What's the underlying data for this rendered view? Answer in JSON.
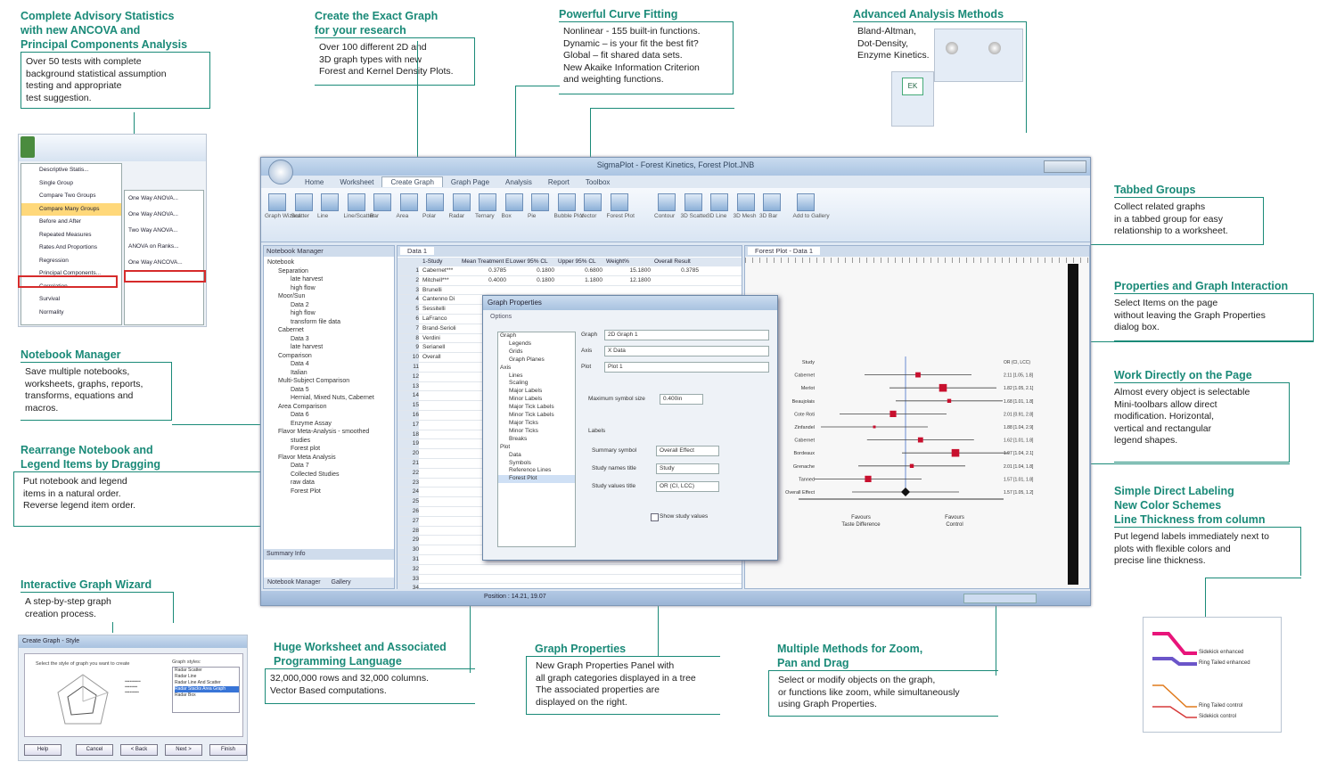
{
  "colors": {
    "accent": "#1a8a78",
    "window": "#dfe8f3",
    "forest_marker": "#c8102e"
  },
  "callouts": {
    "advisory": {
      "title": [
        "Complete Advisory Statistics",
        "with new ANCOVA and",
        "Principal Components Analysis"
      ],
      "body": [
        "Over 50 tests with complete",
        "background statistical assumption",
        "testing and appropriate",
        "test suggestion."
      ]
    },
    "create_graph": {
      "title": [
        "Create the Exact Graph",
        "for your research"
      ],
      "body": [
        "Over 100 different 2D and",
        "3D graph types with new",
        "Forest  and Kernel Density Plots."
      ]
    },
    "curve": {
      "title": [
        "Powerful Curve Fitting"
      ],
      "body": [
        "Nonlinear - 155 built-in functions.",
        "Dynamic – is your fit the best fit?",
        "Global – fit shared data sets.",
        "New Akaike Information Criterion",
        "and weighting functions."
      ]
    },
    "advanced": {
      "title": [
        "Advanced Analysis Methods"
      ],
      "body": [
        "Bland-Altman,",
        "Dot-Density,",
        "Enzyme Kinetics."
      ]
    },
    "tabbed": {
      "title": [
        "Tabbed Groups"
      ],
      "body": [
        "Collect related graphs",
        "in a tabbed group for easy",
        "relationship to a worksheet."
      ]
    },
    "properties_interaction": {
      "title": [
        "Properties and Graph Interaction"
      ],
      "body": [
        "Select Items on the page",
        "without leaving the Graph Properties",
        "dialog box."
      ]
    },
    "work_directly": {
      "title": [
        "Work Directly on the Page"
      ],
      "body": [
        "Almost every object is selectable",
        "Mini-toolbars allow direct",
        "modification. Horizontal,",
        "vertical and rectangular",
        "legend shapes."
      ]
    },
    "labeling": {
      "title": [
        "Simple Direct Labeling",
        "New Color Schemes",
        "Line Thickness from column"
      ],
      "body": [
        "Put legend labels immediately next to",
        "plots with flexible colors and",
        "precise line thickness."
      ]
    },
    "notebook": {
      "title": [
        "Notebook Manager"
      ],
      "body": [
        "Save multiple notebooks,",
        "worksheets, graphs, reports,",
        "transforms, equations and",
        "macros."
      ]
    },
    "rearrange": {
      "title": [
        "Rearrange Notebook and",
        "Legend Items by Dragging"
      ],
      "body": [
        "Put notebook and legend",
        "items in a natural order.",
        "Reverse legend item order."
      ]
    },
    "wizard": {
      "title": [
        "Interactive Graph Wizard"
      ],
      "body": [
        "A step-by-step graph",
        "creation process."
      ]
    },
    "worksheet": {
      "title": [
        "Huge Worksheet and Associated",
        "Programming Language"
      ],
      "body": [
        "32,000,000 rows and 32,000 columns.",
        "Vector Based computations."
      ]
    },
    "graph_props": {
      "title": [
        "Graph Properties"
      ],
      "body": [
        "New Graph Properties Panel with",
        "all graph categories displayed in a tree",
        "The associated properties are",
        "displayed on the right."
      ]
    },
    "zoom": {
      "title": [
        "Multiple Methods for Zoom,",
        "Pan and Drag"
      ],
      "body": [
        "Select or modify objects on the graph,",
        "or functions like zoom, while simultaneously",
        "using Graph Properties."
      ]
    }
  },
  "app": {
    "title": "SigmaPlot - Forest Kinetics, Forest Plot.JNB",
    "tabs": [
      "Home",
      "Worksheet",
      "Create Graph",
      "Graph Page",
      "Analysis",
      "Report",
      "Toolbox"
    ],
    "active_tab": "Create Graph",
    "ribbon_labels": [
      "Graph Wizard",
      "Scatter",
      "Line",
      "Line/Scatter",
      "Bar",
      "Area",
      "Polar",
      "Radar",
      "Ternary",
      "Box",
      "Pie",
      "Bubble Plot",
      "Vector",
      "Forest Plot",
      "Contour",
      "3D Scatter",
      "3D Line",
      "3D Mesh",
      "3D Bar",
      "Add to Gallery"
    ],
    "notebook_title": "Notebook Manager",
    "notebook_items": [
      "Notebook",
      "Separation",
      "late harvest",
      "high flow",
      "Moor/Sun",
      "Data 2",
      "high flow",
      "transform file data",
      "Cabernet",
      "Data 3",
      "late harvest",
      "Comparison",
      "Data 4",
      "Italian",
      "Multi-Subject Comparison",
      "Data 5",
      "Hernial, Mixed Nuts, Cabernet",
      "Area Comparison",
      "Data 6",
      "Enzyme Assay",
      "Flavor Meta-Analysis - smoothed",
      "studies",
      "Forest plot",
      "Flavor Meta Analysis",
      "Data 7",
      "Collected Studies",
      "raw data",
      "Forest Plot"
    ],
    "worksheet_tab": "Data 1",
    "worksheet_cols": [
      "1-Study",
      "Mean Treatment E",
      "Lower 95% CL",
      "Upper 95% CL",
      "Weight%",
      "Overall Result"
    ],
    "worksheet_rows": [
      [
        "Cabernet***",
        "0.3785",
        "0.1800",
        "0.6800",
        "15.1800",
        "0.3785"
      ],
      [
        "Mitchell***",
        "0.4000",
        "0.1800",
        "1.1800",
        "12.1800",
        ""
      ],
      [
        "Brunelli",
        "",
        "",
        "",
        "",
        ""
      ],
      [
        "Cantenno Di",
        "",
        "",
        "",
        "",
        ""
      ],
      [
        "Sessitelli",
        "",
        "",
        "",
        "",
        ""
      ],
      [
        "LaFranco",
        "",
        "",
        "",
        "",
        ""
      ],
      [
        "Brand-Serioli",
        "",
        "",
        "",
        "",
        ""
      ],
      [
        "Verdini",
        "",
        "",
        "",
        "",
        ""
      ],
      [
        "Serianell",
        "",
        "",
        "",
        "",
        ""
      ],
      [
        "Overall",
        "",
        "",
        "",
        "",
        ""
      ]
    ],
    "graph_tab": "Forest Plot - Data 1",
    "summary_info": "Summary Info",
    "bottom_tabs": [
      "Notebook Manager",
      "Gallery"
    ],
    "status": "Position : 14.21, 19.07"
  },
  "dialog": {
    "title": "Graph Properties",
    "options_label": "Options",
    "tree": [
      "Graph",
      "Legends",
      "Grids",
      "Graph Planes",
      "Axis",
      "Lines",
      "Scaling",
      "Major Labels",
      "Minor Labels",
      "Major Tick Labels",
      "Minor Tick Labels",
      "Major Ticks",
      "Minor Ticks",
      "Breaks",
      "Plot",
      "Data",
      "Symbols",
      "Reference Lines",
      "Forest Plot"
    ],
    "fields": [
      {
        "label": "Graph",
        "value": "2D Graph 1"
      },
      {
        "label": "Axis",
        "value": "X Data"
      },
      {
        "label": "Plot",
        "value": "Plot 1"
      }
    ],
    "max_symbol_label": "Maximum symbol size",
    "max_symbol_value": "0.400in",
    "labels_heading": "Labels",
    "label_fields": [
      {
        "label": "Summary symbol",
        "value": "Overall Effect"
      },
      {
        "label": "Study names title",
        "value": "Study"
      },
      {
        "label": "Study values title",
        "value": "OR (CI, LCC)"
      }
    ],
    "checkbox": "Show study values"
  },
  "forest": {
    "studies": [
      "Study",
      "Cabernet",
      "Merlot",
      "Beaujolais",
      "Cote Roti",
      "Zinfandel",
      "Cabernet",
      "Bordeaux",
      "Grenache",
      "Tanned",
      "Overall Effect"
    ],
    "values": [
      "OR (CI, LCC)",
      "2.11 [1.05, 1.8]",
      "1.82 [1.05, 2.1]",
      "1.68 [1.01, 1.8]",
      "2.01 [0.91, 2.8]",
      "1.88 [1.04, 2.9]",
      "1.62 [1.01, 1.8]",
      "1.97 [1.04, 2.1]",
      "2.01 [1.04, 1.8]",
      "1.57 [1.01, 1.8]",
      "1.57 [1.05, 1.2]"
    ],
    "estimates": [
      0.1,
      0.3,
      0.35,
      -0.1,
      -0.25,
      0.12,
      0.4,
      0.05,
      -0.3,
      0.0
    ],
    "x_left": "Favours\nTaste Difference",
    "x_right": "Favours\nControl"
  },
  "side_menu": {
    "items": [
      "Descriptive Statis...",
      "Single Group",
      "Compare Two Groups",
      "Compare Many Groups",
      "Before and After",
      "Repeated Measures",
      "Rates And Proportions",
      "Regression",
      "Principal Components...",
      "Correlation",
      "Survival",
      "Normality"
    ],
    "submenu": [
      "One Way ANOVA...",
      "One Way ANOVA...",
      "Two Way ANOVA...",
      "ANOVA on Ranks...",
      "One Way ANCOVA..."
    ]
  },
  "wizard_dialog": {
    "title": "Create Graph - Style",
    "prompt": "Select the style of graph you want to create",
    "list_title": "Graph styles:",
    "styles": [
      "Radar Scatter",
      "Radar Line",
      "Radar Line And Scatter",
      "Radar Stacks Area Graph",
      "Radar Box"
    ],
    "buttons": [
      "Help",
      "Cancel",
      "< Back",
      "Next >",
      "Finish"
    ]
  },
  "legend_thumb": {
    "items": [
      "Sidekick enhanced",
      "Ring Tailed enhanced",
      "Ring Tailed control",
      "Sidekick control"
    ]
  }
}
